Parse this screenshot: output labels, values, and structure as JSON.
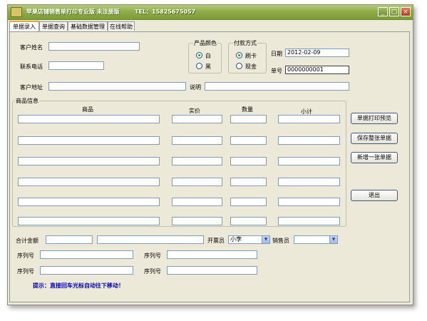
{
  "window": {
    "title": "苹果店铺销售单打印专业版  未注册版",
    "tel": "TEL：15825675057",
    "minimize": "_",
    "maximize": "□",
    "close": "×"
  },
  "tabs": [
    "单据录入",
    "单据查询",
    "基础数据管理",
    "在线帮助"
  ],
  "customer": {
    "name_label": "客户姓名",
    "name_value": "",
    "phone_label": "联系电话",
    "phone_value": "",
    "address_label": "客户地址",
    "address_value": "",
    "note_label": "说明",
    "note_value": ""
  },
  "product_color": {
    "title": "产品颜色",
    "options": [
      "白",
      "黑"
    ],
    "selected": "白"
  },
  "payment": {
    "title": "付款方式",
    "options": [
      "刷卡",
      "现金"
    ],
    "selected": "刷卡"
  },
  "date": {
    "label": "日期",
    "value": "2012-02-09"
  },
  "order_no": {
    "label": "单号",
    "value": "0000000001"
  },
  "goods": {
    "title": "商品信息",
    "columns": [
      "商品",
      "实价",
      "数量",
      "小计"
    ],
    "rows": [
      [
        "",
        "",
        "",
        ""
      ],
      [
        "",
        "",
        "",
        ""
      ],
      [
        "",
        "",
        "",
        ""
      ],
      [
        "",
        "",
        "",
        ""
      ],
      [
        "",
        "",
        "",
        ""
      ],
      [
        "",
        "",
        "",
        ""
      ]
    ]
  },
  "buttons": {
    "print_preview": "单据打印预览",
    "save": "保存整张单据",
    "new": "新增一张单据",
    "exit": "退出"
  },
  "totals": {
    "total_label": "合计金额",
    "total_value": "",
    "total_words": "",
    "issuer_label": "开票员",
    "issuer_value": "小李",
    "seller_label": "销售员",
    "seller_value": ""
  },
  "serials": {
    "label": "序列号",
    "values": [
      "",
      "",
      "",
      ""
    ]
  },
  "hint": "提示：直接回车光标自动往下移动！"
}
